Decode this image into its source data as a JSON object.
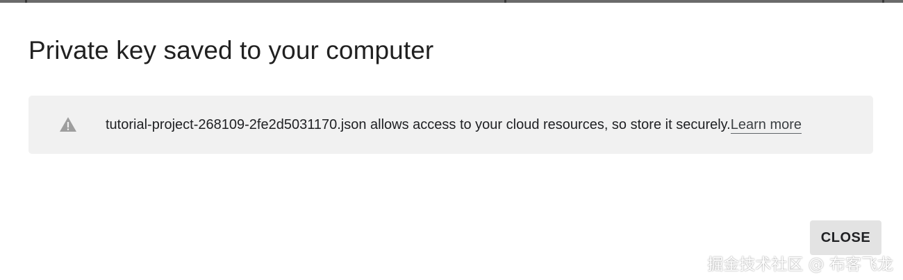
{
  "dialog": {
    "title": "Private key saved to your computer",
    "notice": {
      "icon": "warning-triangle-icon",
      "text": "tutorial-project-268109-2fe2d5031170.json allows access to your cloud resources, so store it securely.",
      "link_label": "Learn more"
    },
    "close_label": "CLOSE"
  },
  "watermark": "掘金技术社区 @ 布客飞龙",
  "colors": {
    "notice_background": "#f1f1f1",
    "close_button_background": "#e3e3e3",
    "icon_gray": "#9e9e9e"
  }
}
